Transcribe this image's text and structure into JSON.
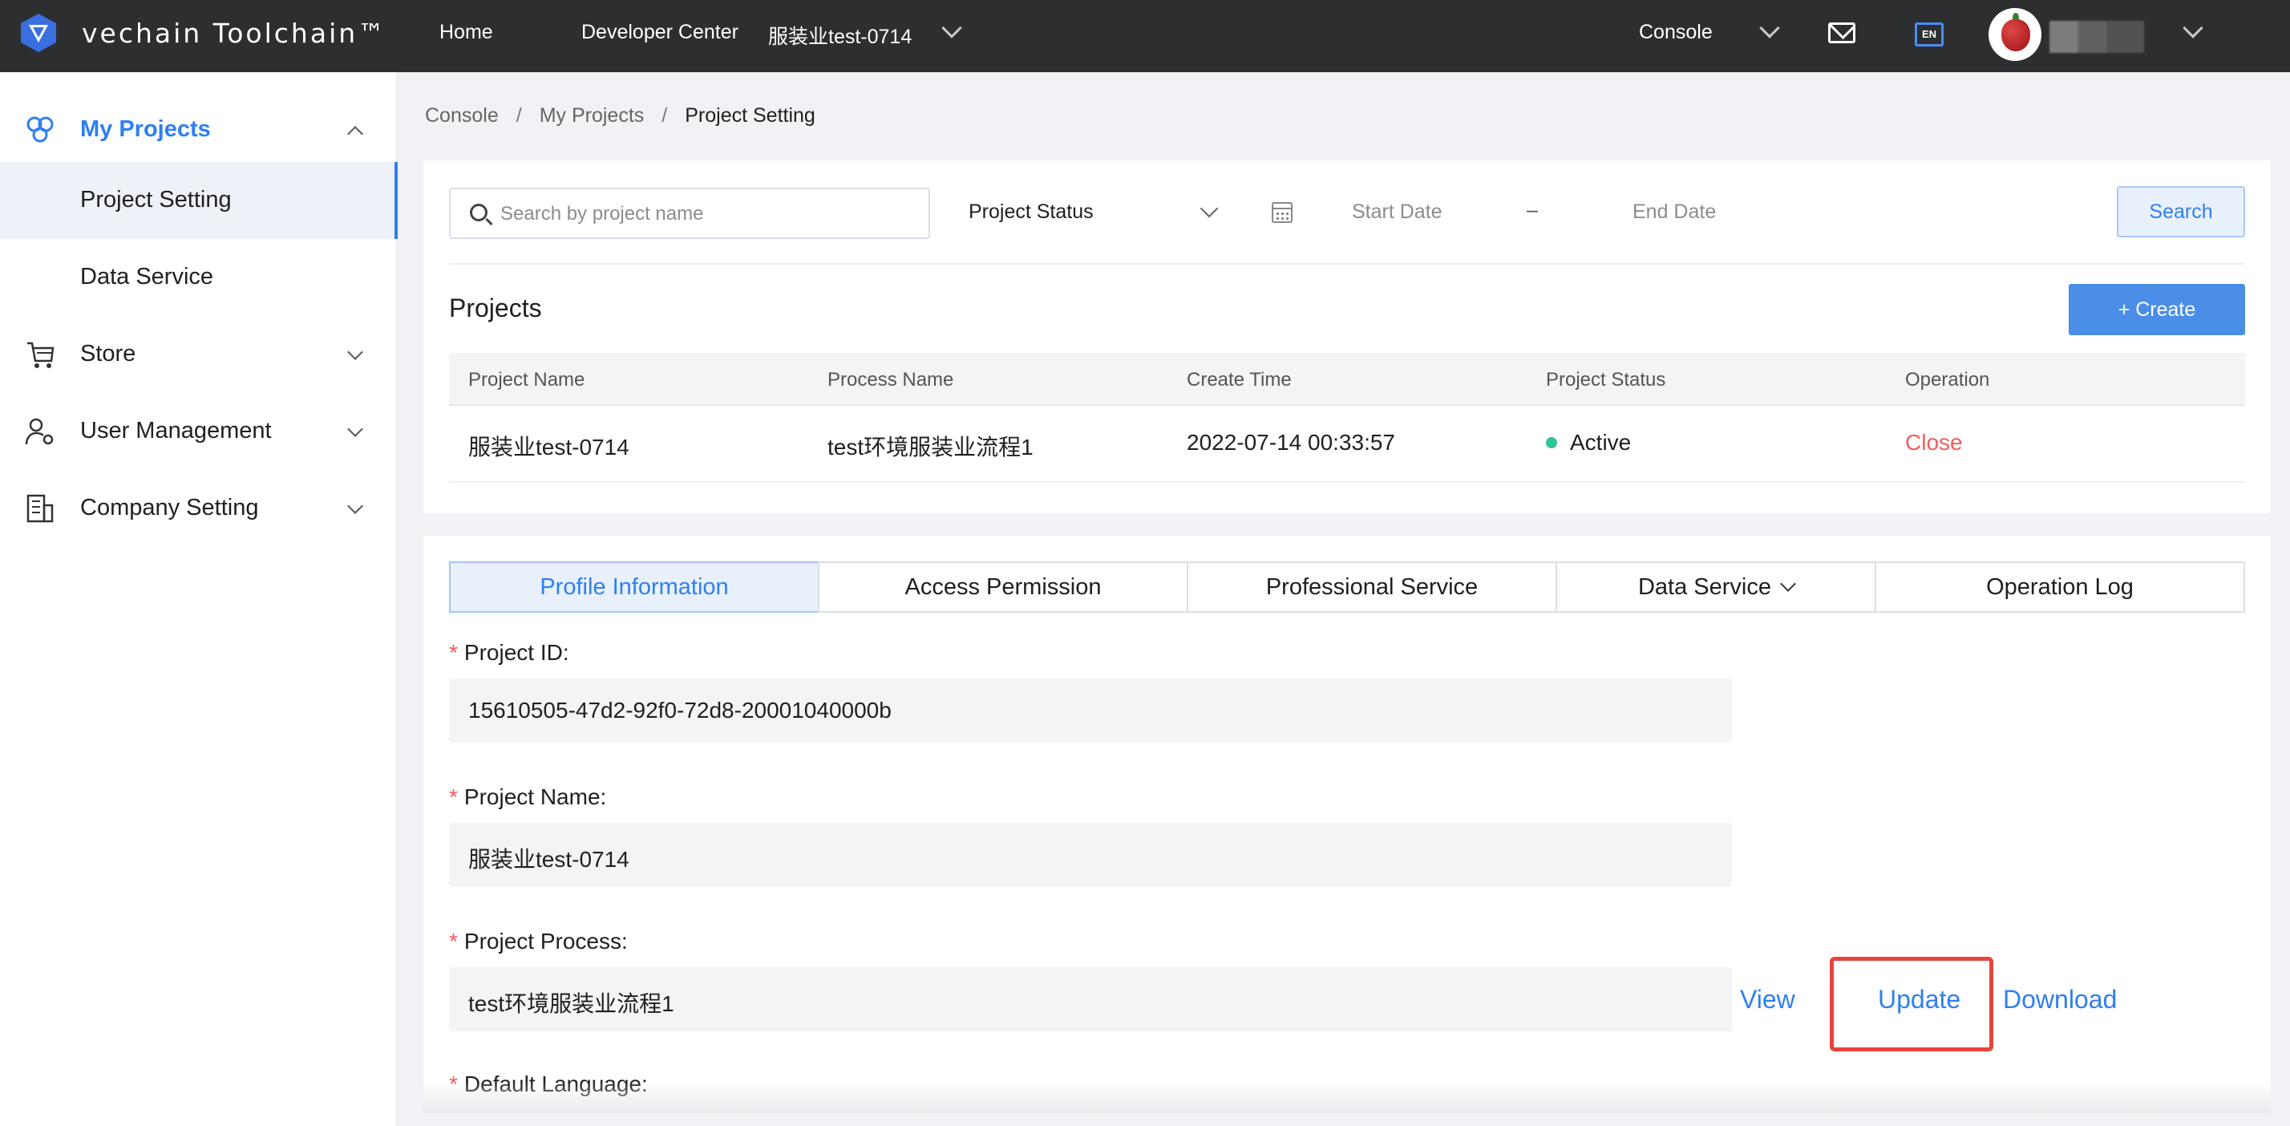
{
  "topbar": {
    "brand": "vechain Toolchain™",
    "nav": {
      "home": "Home",
      "developer_center": "Developer Center",
      "project_switch": "服装业test-0714",
      "console": "Console"
    },
    "language_badge": "EN",
    "icons": [
      "vechain-logo-icon",
      "mail-icon",
      "language-icon",
      "avatar"
    ]
  },
  "sidebar": {
    "items": [
      {
        "label": "My Projects",
        "icon": "projects-icon",
        "expanded": true
      },
      {
        "label": "Project Setting",
        "selected": true
      },
      {
        "label": "Data Service"
      },
      {
        "label": "Store",
        "icon": "store-cart-icon"
      },
      {
        "label": "User Management",
        "icon": "user-settings-icon"
      },
      {
        "label": "Company Setting",
        "icon": "building-icon"
      }
    ]
  },
  "breadcrumb": {
    "items": [
      "Console",
      "My Projects",
      "Project Setting"
    ],
    "separator": "/"
  },
  "filters": {
    "search_placeholder": "Search by project name",
    "status_label": "Project Status",
    "start_date": "Start Date",
    "date_separator": "–",
    "end_date": "End Date",
    "search_button": "Search"
  },
  "projects": {
    "title": "Projects",
    "create_button": "+ Create",
    "columns": [
      "Project Name",
      "Process Name",
      "Create Time",
      "Project Status",
      "Operation"
    ],
    "rows": [
      {
        "project_name": "服装业test-0714",
        "process_name": "test环境服装业流程1",
        "create_time": "2022-07-14 00:33:57",
        "status": "Active",
        "operation": "Close"
      }
    ]
  },
  "detail": {
    "tabs": [
      "Profile Information",
      "Access Permission",
      "Professional Service",
      "Data Service",
      "Operation Log"
    ],
    "active_tab": "Profile Information",
    "fields": {
      "project_id_label": "Project ID:",
      "project_id_value": "15610505-47d2-92f0-72d8-20001040000b",
      "project_name_label": "Project Name:",
      "project_name_value": "服装业test-0714",
      "project_process_label": "Project Process:",
      "project_process_value": "test环境服装业流程1",
      "default_language_label": "Default Language:"
    },
    "required_mark": "*",
    "actions": {
      "view": "View",
      "update": "Update",
      "download": "Download"
    }
  },
  "colors": {
    "topbar_bg": "#2d2e30",
    "accent": "#2f7ff0",
    "danger": "#f25b5b",
    "active_status": "#2fc49a",
    "highlight_box": "#e8433b"
  }
}
